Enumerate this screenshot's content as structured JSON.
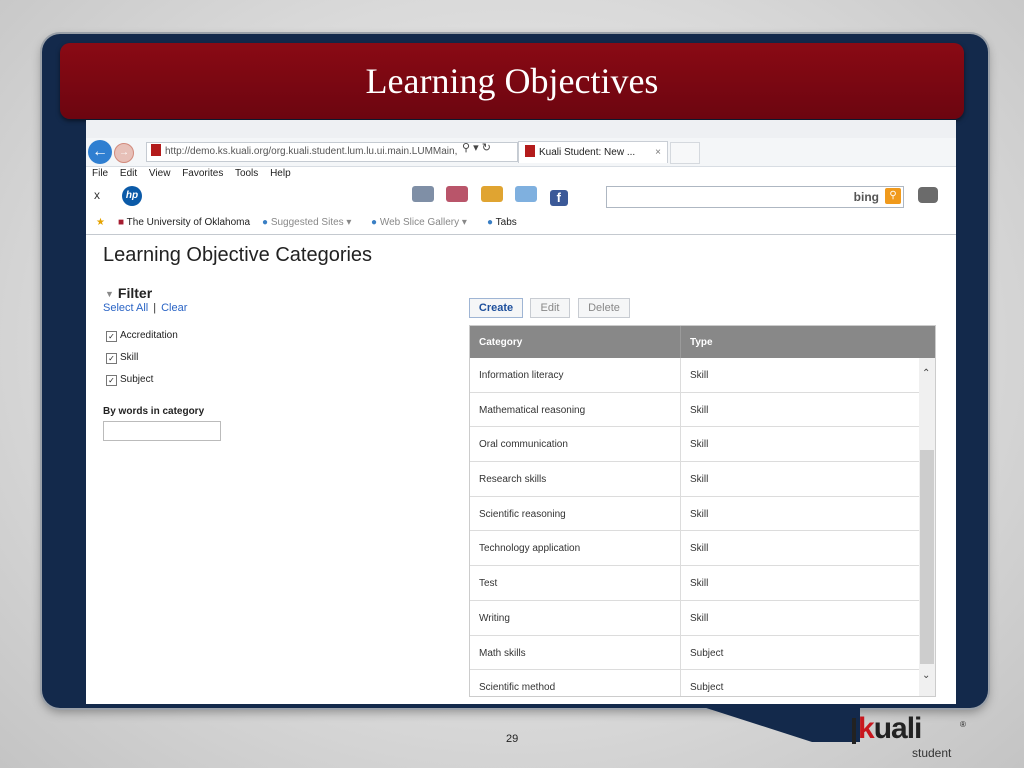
{
  "slide": {
    "title": "Learning Objectives",
    "page_number": "29"
  },
  "browser": {
    "url": "http://demo.ks.kuali.org/org.kuali.student.lum.lu.ui.main.LUMMain,",
    "tab_title": "Kuali Student: New ...",
    "menu": [
      "File",
      "Edit",
      "View",
      "Favorites",
      "Tools",
      "Help"
    ],
    "close_x": "x",
    "hp_logo": "hp",
    "search_engine": "bing",
    "facebook": "f",
    "favorites": [
      {
        "label": "The University of Oklahoma"
      },
      {
        "label": "Suggested Sites ▾"
      },
      {
        "label": "Web Slice Gallery ▾"
      },
      {
        "label": "Tabs"
      }
    ]
  },
  "app": {
    "heading": "Learning Objective Categories",
    "filter": {
      "title": "Filter",
      "select_all": "Select All",
      "separator": "|",
      "clear": "Clear",
      "checkboxes": [
        {
          "label": "Accreditation",
          "checked": true
        },
        {
          "label": "Skill",
          "checked": true
        },
        {
          "label": "Subject",
          "checked": true
        }
      ],
      "words_label": "By words in category",
      "words_value": ""
    },
    "buttons": {
      "create": "Create",
      "edit": "Edit",
      "delete": "Delete"
    },
    "table": {
      "headers": [
        "Category",
        "Type"
      ],
      "rows": [
        [
          "Information literacy",
          "Skill"
        ],
        [
          "Mathematical reasoning",
          "Skill"
        ],
        [
          "Oral communication",
          "Skill"
        ],
        [
          "Research skills",
          "Skill"
        ],
        [
          "Scientific reasoning",
          "Skill"
        ],
        [
          "Technology application",
          "Skill"
        ],
        [
          "Test",
          "Skill"
        ],
        [
          "Writing",
          "Skill"
        ],
        [
          "Math skills",
          "Subject"
        ],
        [
          "Scientific method",
          "Subject"
        ]
      ]
    }
  },
  "logo": {
    "brand": "uali",
    "brand_k": "k",
    "sub": "student",
    "reg": "®"
  },
  "colors": {
    "title_bar": "#7d0812",
    "frame": "#13294b",
    "link": "#2a64c5",
    "table_header": "#888888"
  }
}
